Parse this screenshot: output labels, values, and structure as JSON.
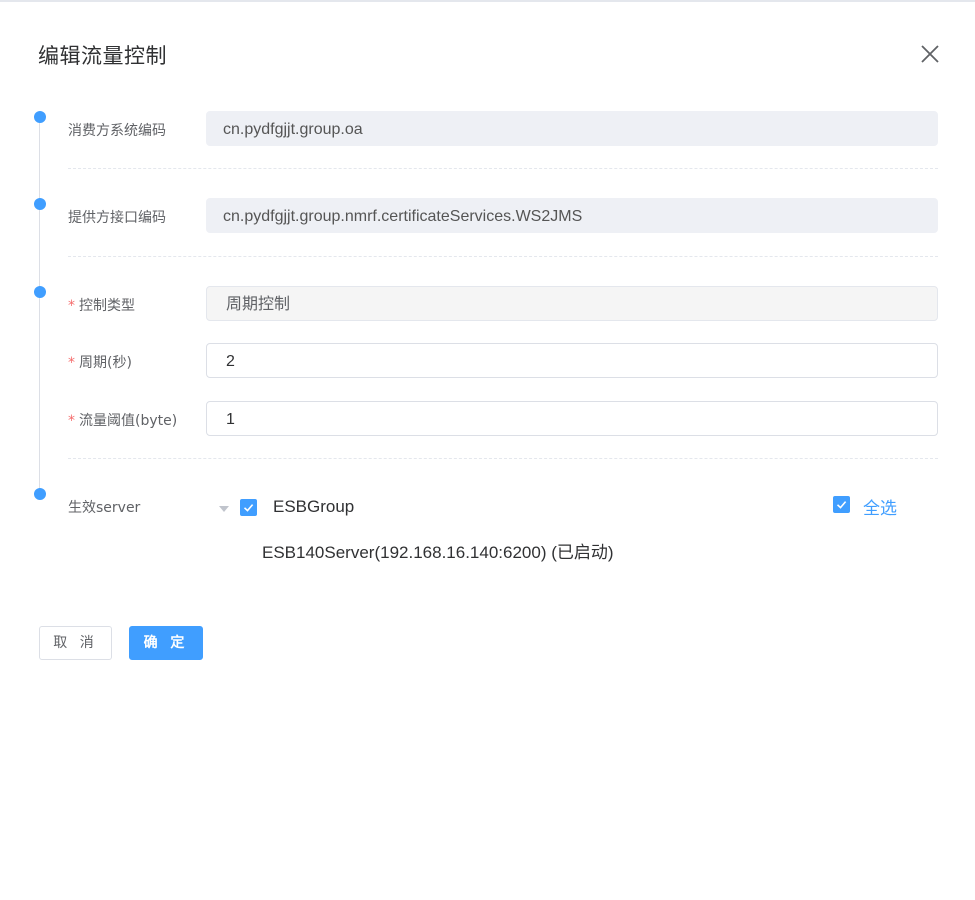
{
  "dialog": {
    "title": "编辑流量控制"
  },
  "form": {
    "consumer_code": {
      "label": "消费方系统编码",
      "value": "cn.pydfgjjt.group.oa"
    },
    "provider_code": {
      "label": "提供方接口编码",
      "value": "cn.pydfgjjt.group.nmrf.certificateServices.WS2JMS"
    },
    "control_type": {
      "required_mark": "*",
      "label": "控制类型",
      "value": "周期控制"
    },
    "period": {
      "required_mark": "*",
      "label": "周期(秒)",
      "value": "2"
    },
    "threshold": {
      "required_mark": "*",
      "label": "流量阈值(byte)",
      "value": "1"
    },
    "servers": {
      "label": "生效server",
      "group_name": "ESBGroup",
      "group_checked": true,
      "server_item": "ESB140Server(192.168.16.140:6200) (已启动)",
      "select_all_label": "全选",
      "select_all_checked": true
    }
  },
  "footer": {
    "cancel_label": "取 消",
    "ok_label": "确 定"
  },
  "colors": {
    "accent": "#409eff",
    "required": "#f56c6c"
  },
  "icons": [
    "close-icon",
    "caret-down-icon",
    "check-icon"
  ]
}
